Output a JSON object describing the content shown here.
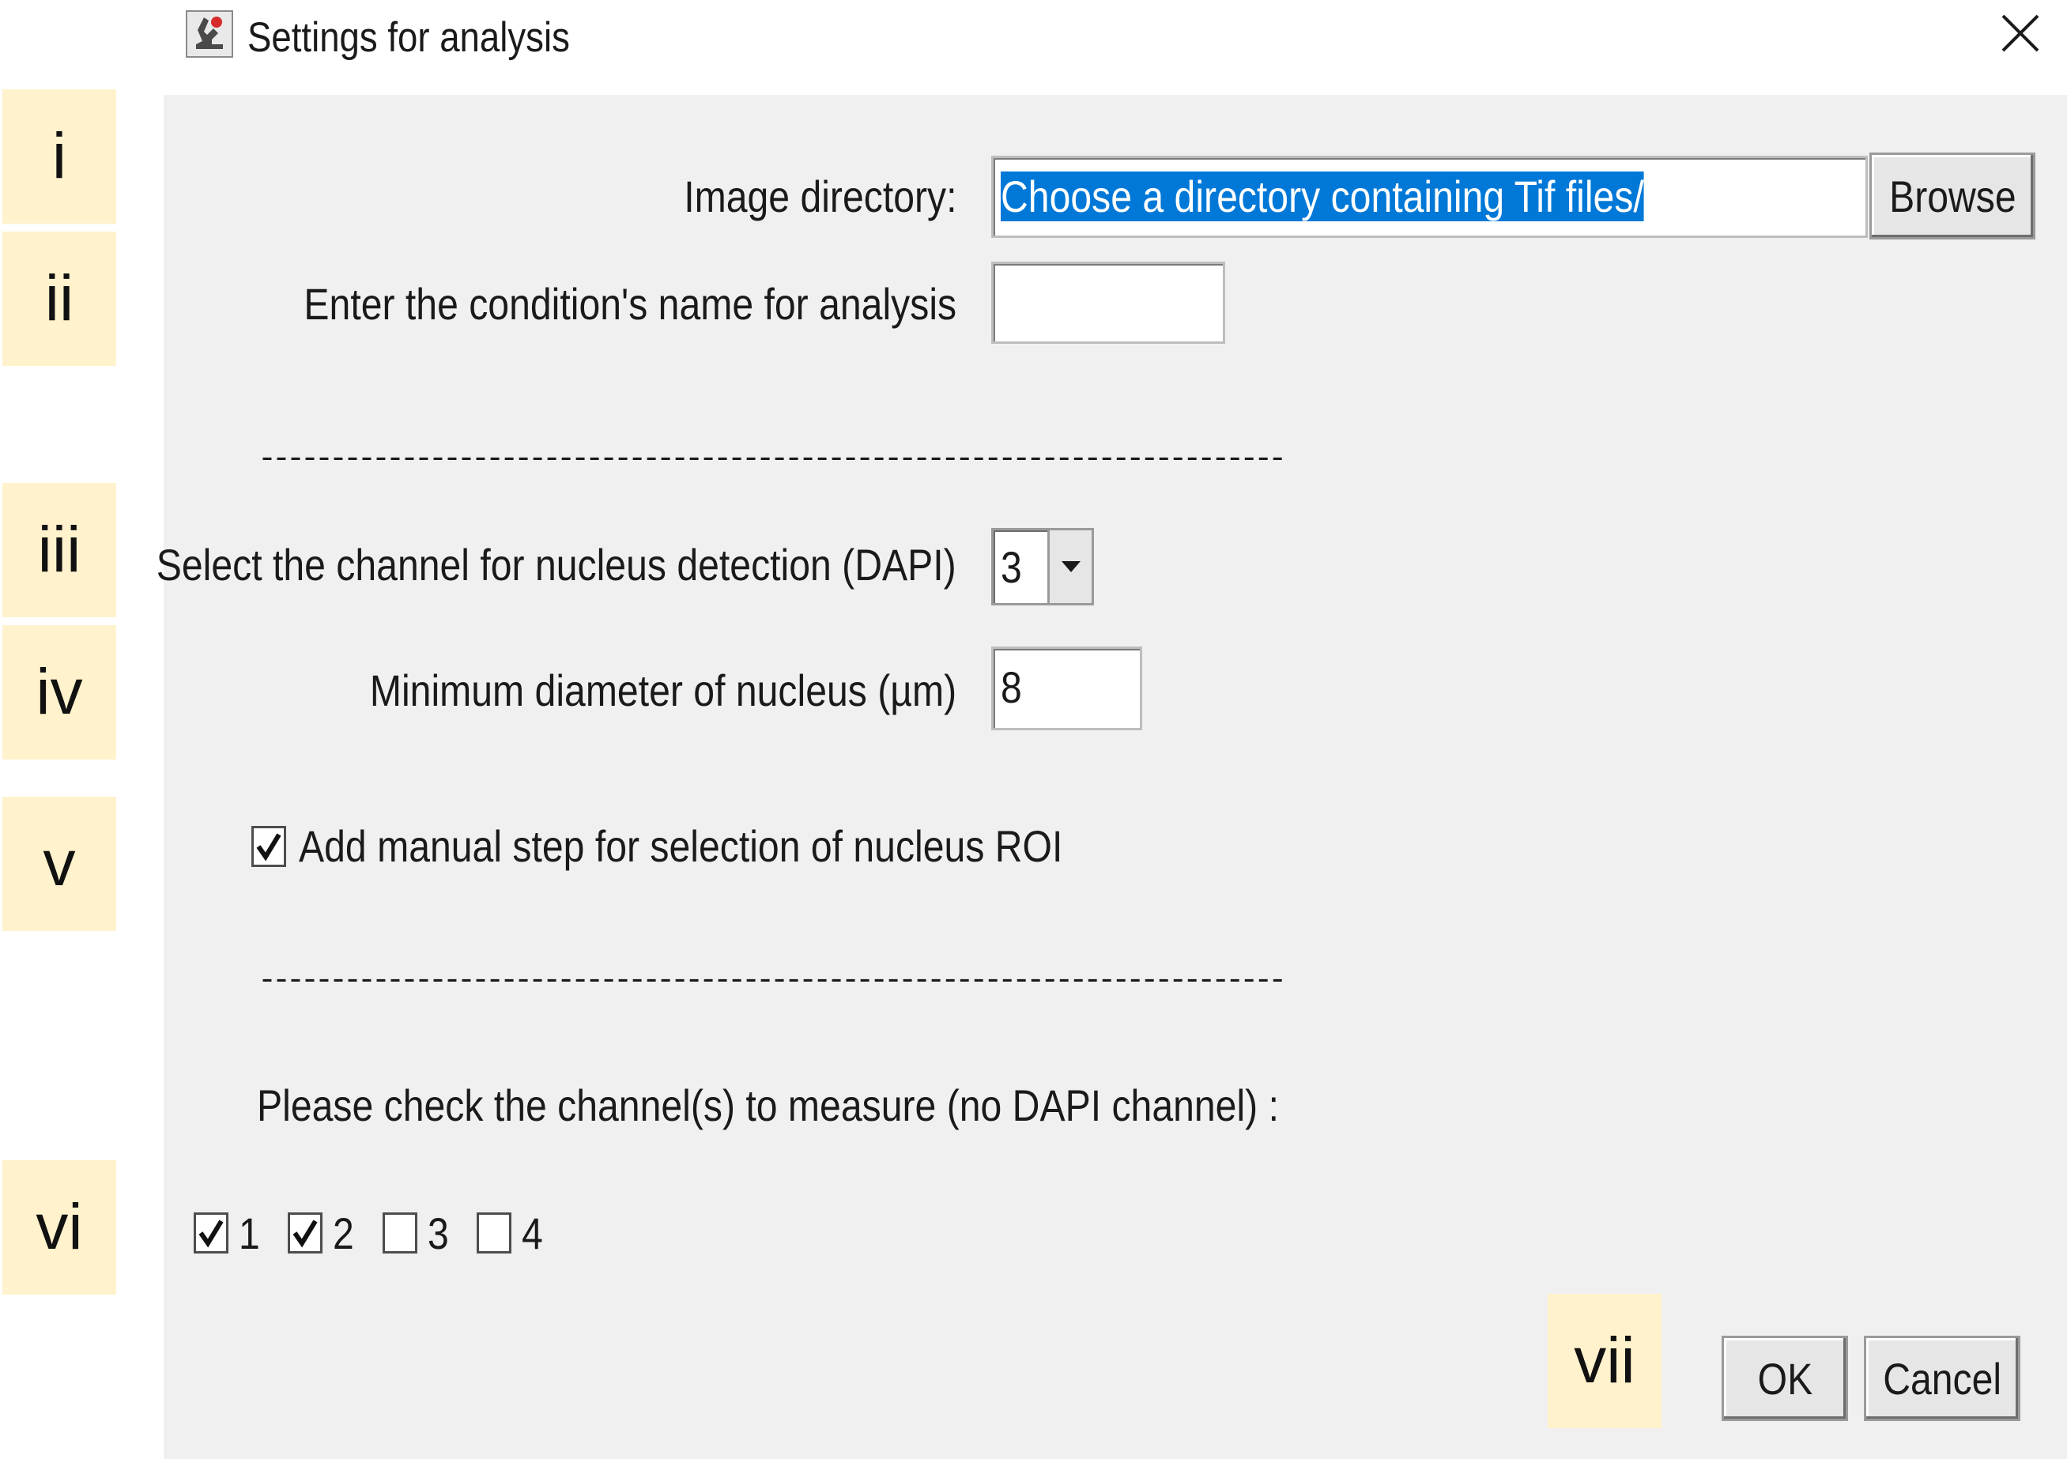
{
  "window": {
    "title": "Settings for analysis",
    "icon": "imagej-microscope-icon",
    "close_icon": "close-icon"
  },
  "annotations": [
    "i",
    "ii",
    "iii",
    "iv",
    "v",
    "vi",
    "vii"
  ],
  "image_directory": {
    "label": "Image directory:",
    "value": "Choose a directory containing Tif files/",
    "browse_label": "Browse"
  },
  "condition": {
    "label": "Enter the condition's name for analysis",
    "value": ""
  },
  "separator": "------------------------------------------------------------------------",
  "nucleus_channel": {
    "label": "Select the channel for nucleus detection (DAPI)",
    "selected": "3"
  },
  "min_diameter": {
    "label": "Minimum diameter of nucleus (µm)",
    "value": "8"
  },
  "manual_step": {
    "label": "Add manual step for selection of nucleus ROI",
    "checked": true
  },
  "measure": {
    "prompt": "Please check the channel(s) to measure (no DAPI channel) :",
    "channels": [
      {
        "label": "1",
        "checked": true
      },
      {
        "label": "2",
        "checked": true
      },
      {
        "label": "3",
        "checked": false
      },
      {
        "label": "4",
        "checked": false
      }
    ]
  },
  "buttons": {
    "ok": "OK",
    "cancel": "Cancel"
  },
  "colors": {
    "panel": "#f0f0f0",
    "annotation_tag": "#fff2cc",
    "selection": "#0078d7"
  }
}
